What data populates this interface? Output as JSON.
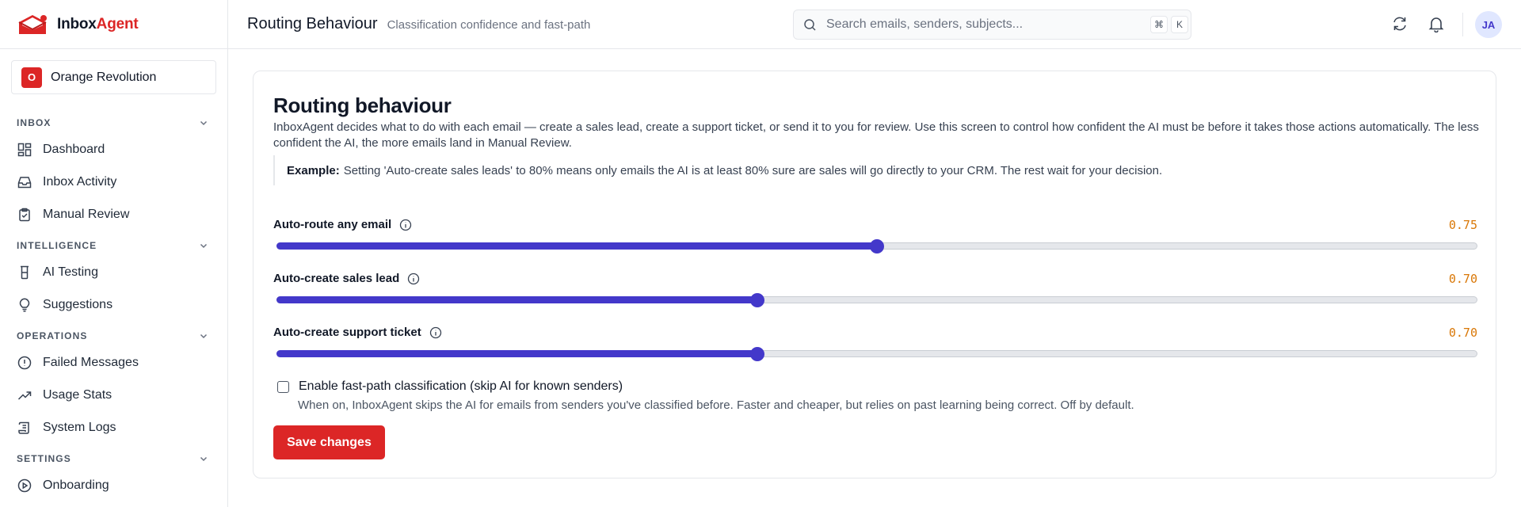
{
  "app": {
    "brand_part1": "Inbox",
    "brand_part2": "Agent",
    "workspace_initial": "O",
    "workspace_name": "Orange Revolution",
    "brand_color": "#dc2626",
    "accent_color": "#4338ca"
  },
  "sidebar": {
    "sections": [
      {
        "title": "INBOX",
        "items": [
          {
            "label": "Dashboard",
            "icon": "dashboard-icon"
          },
          {
            "label": "Inbox Activity",
            "icon": "inbox-icon"
          },
          {
            "label": "Manual Review",
            "icon": "clipboard-check-icon"
          }
        ]
      },
      {
        "title": "INTELLIGENCE",
        "items": [
          {
            "label": "AI Testing",
            "icon": "test-tube-icon"
          },
          {
            "label": "Suggestions",
            "icon": "lightbulb-icon"
          }
        ]
      },
      {
        "title": "OPERATIONS",
        "items": [
          {
            "label": "Failed Messages",
            "icon": "alert-circle-icon"
          },
          {
            "label": "Usage Stats",
            "icon": "trending-up-icon"
          },
          {
            "label": "System Logs",
            "icon": "scroll-icon"
          }
        ]
      },
      {
        "title": "SETTINGS",
        "items": [
          {
            "label": "Onboarding",
            "icon": "play-circle-icon"
          }
        ]
      }
    ]
  },
  "header": {
    "title": "Routing Behaviour",
    "subtitle": "Classification confidence and fast-path",
    "search_placeholder": "Search emails, senders, subjects...",
    "shortcut_cmd": "⌘",
    "shortcut_key": "K",
    "avatar_initials": "JA"
  },
  "main": {
    "title": "Routing behaviour",
    "description": "InboxAgent decides what to do with each email — create a sales lead, create a support ticket, or send it to you for review. Use this screen to control how confident the AI must be before it takes those actions automatically. The less confident the AI, the more emails land in Manual Review.",
    "example_label": "Example:",
    "example_text": "Setting 'Auto-create sales leads' to 80% means only emails the AI is at least 80% sure are sales will go directly to your CRM. The rest wait for your decision.",
    "sliders": [
      {
        "label": "Auto-route any email",
        "value_text": "0.75",
        "value": 0.75
      },
      {
        "label": "Auto-create sales lead",
        "value_text": "0.70",
        "value": 0.7
      },
      {
        "label": "Auto-create support ticket",
        "value_text": "0.70",
        "value": 0.7
      }
    ],
    "fastpath_label": "Enable fast-path classification (skip AI for known senders)",
    "fastpath_checked": false,
    "fastpath_help": "When on, InboxAgent skips the AI for emails from senders you've classified before. Faster and cheaper, but relies on past learning being correct. Off by default.",
    "save_label": "Save changes"
  }
}
